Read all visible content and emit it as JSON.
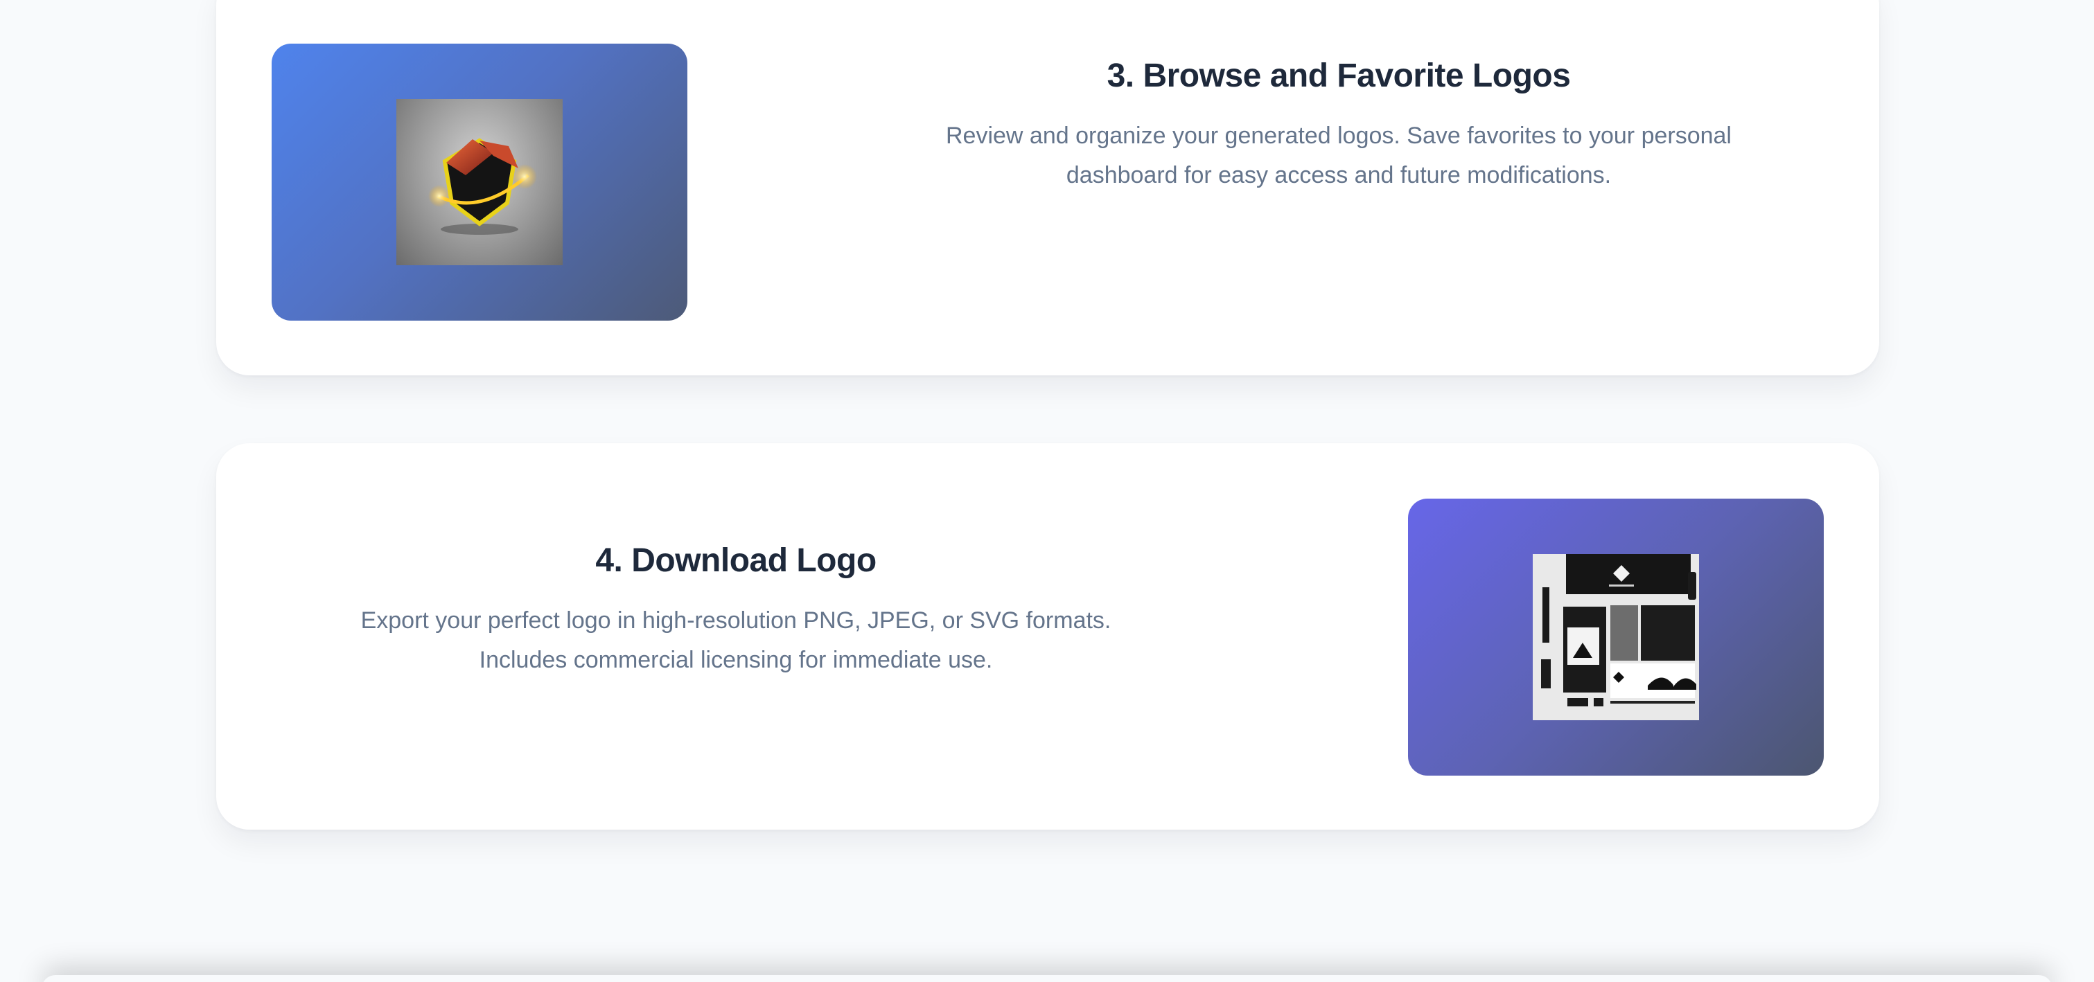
{
  "steps": [
    {
      "title": "3. Browse and Favorite Logos",
      "description_line1": "Review and organize your generated logos. Save favorites to your personal",
      "description_line2": "dashboard for easy access and future modifications.",
      "image_alt": "generated logo preview"
    },
    {
      "title": "4. Download Logo",
      "description_line1": "Export your perfect logo in high-resolution PNG, JPEG, or SVG formats.",
      "description_line2": "Includes commercial licensing for immediate use.",
      "image_alt": "brand mockup preview"
    }
  ],
  "colors": {
    "background": "#f8fafc",
    "card": "#ffffff",
    "title": "#1e293b",
    "description": "#64748b",
    "gradient_blue": "#4f83ec",
    "gradient_purple": "#6766e8"
  }
}
